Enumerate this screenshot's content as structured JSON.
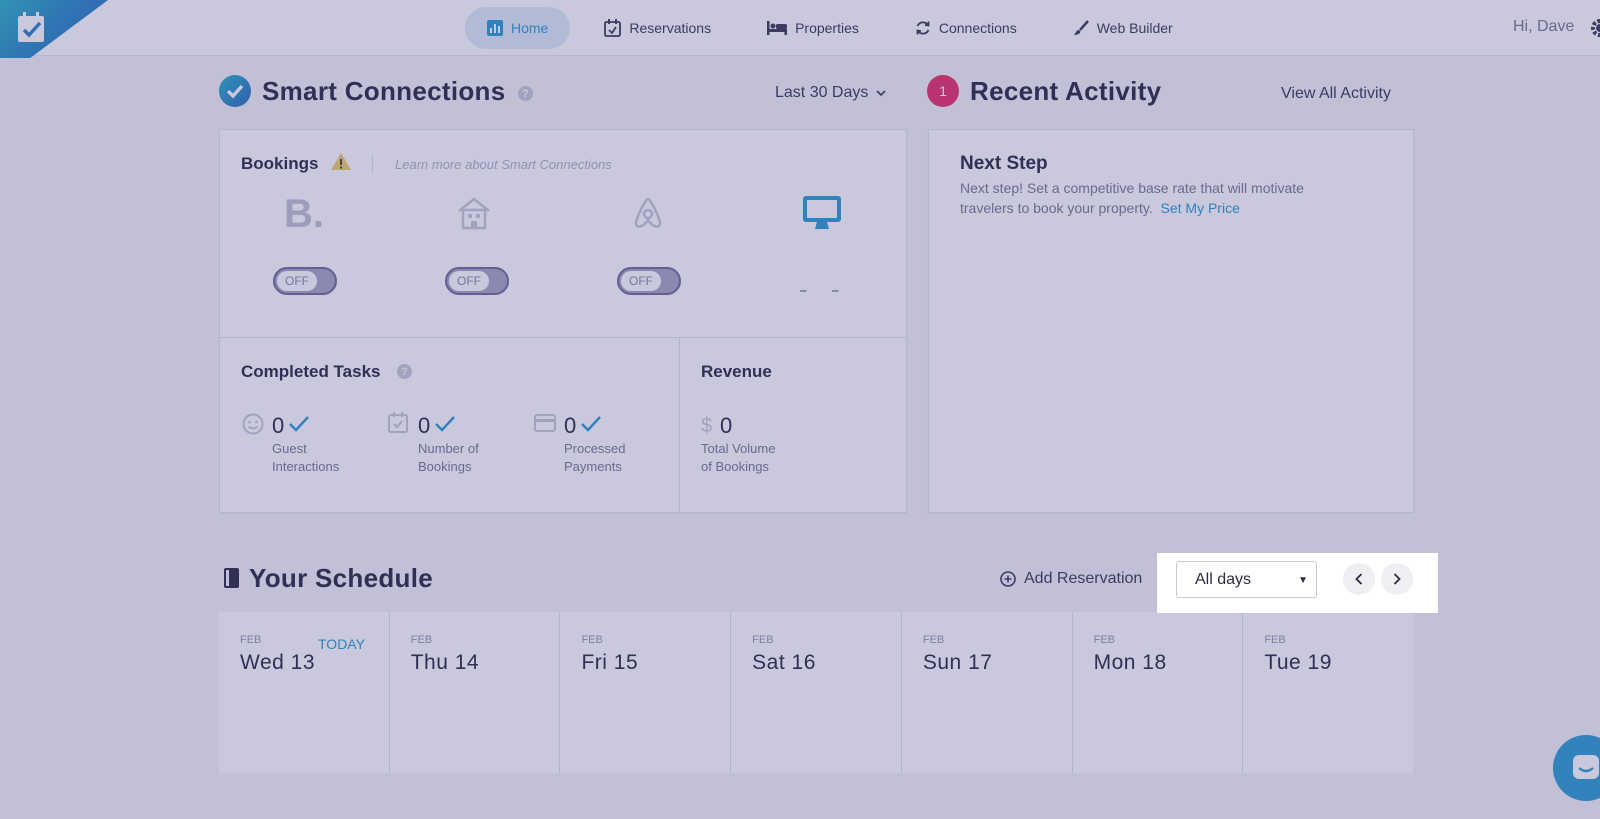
{
  "nav": {
    "items": [
      {
        "label": "Home",
        "icon": "bar-chart-icon"
      },
      {
        "label": "Reservations",
        "icon": "calendar-check-icon"
      },
      {
        "label": "Properties",
        "icon": "bed-icon"
      },
      {
        "label": "Connections",
        "icon": "sync-icon"
      },
      {
        "label": "Web Builder",
        "icon": "brush-icon"
      }
    ],
    "greeting": "Hi, Dave"
  },
  "smart": {
    "title": "Smart Connections",
    "range": "Last 30 Days",
    "bookings_label": "Bookings",
    "learn_more": "Learn more about Smart Connections",
    "channel_logo_text": "B.",
    "toggle_off": "OFF",
    "direct_value": "- -"
  },
  "tasks": {
    "title": "Completed Tasks",
    "stats": [
      {
        "value": "0",
        "label1": "Guest",
        "label2": "Interactions"
      },
      {
        "value": "0",
        "label1": "Number of",
        "label2": "Bookings"
      },
      {
        "value": "0",
        "label1": "Processed",
        "label2": "Payments"
      }
    ]
  },
  "revenue": {
    "title": "Revenue",
    "currency": "$",
    "value": "0",
    "label1": "Total Volume",
    "label2": "of Bookings"
  },
  "activity": {
    "badge": "1",
    "title": "Recent Activity",
    "view_all": "View All Activity",
    "next_title": "Next Step",
    "next_text": "Next step! Set a competitive base rate that will motivate travelers to book your property.",
    "next_link": "Set My Price"
  },
  "schedule": {
    "title": "Your Schedule",
    "add": "Add Reservation",
    "filter": "All days",
    "days": [
      {
        "month": "FEB",
        "name": "Wed 13",
        "today": "TODAY"
      },
      {
        "month": "FEB",
        "name": "Thu 14"
      },
      {
        "month": "FEB",
        "name": "Fri 15"
      },
      {
        "month": "FEB",
        "name": "Sat 16"
      },
      {
        "month": "FEB",
        "name": "Sun 17"
      },
      {
        "month": "FEB",
        "name": "Mon 18"
      },
      {
        "month": "FEB",
        "name": "Tue 19"
      }
    ]
  },
  "colors": {
    "accent": "#2c9ed4",
    "alert": "#e8336b",
    "overlay": "#3c3882"
  }
}
